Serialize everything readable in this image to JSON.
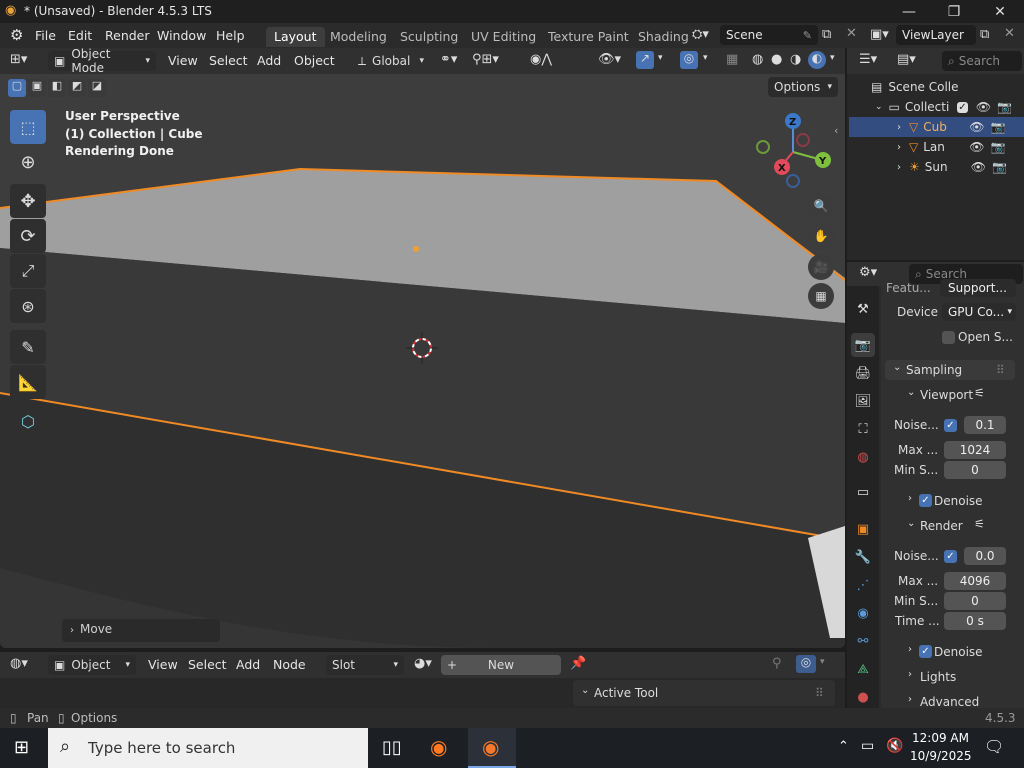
{
  "window": {
    "title": "* (Unsaved) - Blender 4.5.3 LTS",
    "minimize": "—",
    "maximize": "❐",
    "close": "✕"
  },
  "menubar": {
    "items": [
      "File",
      "Edit",
      "Render",
      "Window",
      "Help"
    ]
  },
  "workspaces": {
    "tabs": [
      "Layout",
      "Modeling",
      "Sculpting",
      "UV Editing",
      "Texture Paint",
      "Shading"
    ],
    "active": "Layout"
  },
  "scene": {
    "name": "Scene"
  },
  "view_layer": {
    "name": "ViewLayer"
  },
  "viewport_header": {
    "mode": "Object Mode",
    "menus": [
      "View",
      "Select",
      "Add",
      "Object"
    ],
    "transform_orientation": "Global",
    "options_label": "Options"
  },
  "viewport_overlay": {
    "perspective": "User Perspective",
    "collection": "(1) Collection | Cube",
    "status": "Rendering Done"
  },
  "gizmo": {
    "x": "X",
    "y": "Y",
    "z": "Z"
  },
  "last_operator": {
    "label": "Move"
  },
  "outliner": {
    "search_placeholder": "Search",
    "scene_collection": "Scene Colle",
    "collection": "Collecti",
    "items": [
      {
        "name": "Cub",
        "selected": true,
        "icon": "mesh-icon"
      },
      {
        "name": "Lan",
        "selected": false,
        "icon": "mesh-icon"
      },
      {
        "name": "Sun",
        "selected": false,
        "icon": "light-icon"
      }
    ]
  },
  "properties": {
    "search_placeholder": "Search",
    "feature_label": "Featu...",
    "feature_value": "Support...",
    "device_label": "Device",
    "device_value": "GPU Co...",
    "open_shading": "Open S...",
    "sampling": "Sampling",
    "viewport": "Viewport",
    "viewport_noise_label": "Noise...",
    "viewport_noise": "0.1",
    "viewport_max_label": "Max ...",
    "viewport_max": "1024",
    "viewport_min_label": "Min S...",
    "viewport_min": "0",
    "denoise_label": "Denoise",
    "render": "Render",
    "render_noise_label": "Noise...",
    "render_noise": "0.0",
    "render_max_label": "Max ...",
    "render_max": "4096",
    "render_min_label": "Min S...",
    "render_min": "0",
    "time_label": "Time ...",
    "time_value": "0 s",
    "denoise2_label": "Denoise",
    "lights": "Lights",
    "advanced": "Advanced"
  },
  "node_editor": {
    "type": "Object",
    "menus": [
      "View",
      "Select",
      "Add",
      "Node"
    ],
    "slot": "Slot",
    "new_label": "New",
    "active_tool": "Active Tool"
  },
  "statusbar": {
    "pan": "Pan",
    "options": "Options",
    "version": "4.5.3"
  },
  "taskbar": {
    "search_placeholder": "Type here to search",
    "time": "12:09 AM",
    "date": "10/9/2025"
  },
  "colors": {
    "accent": "#4772b3",
    "selection_outline": "#f08a24",
    "viewport_bg": "#3b3b3b"
  }
}
